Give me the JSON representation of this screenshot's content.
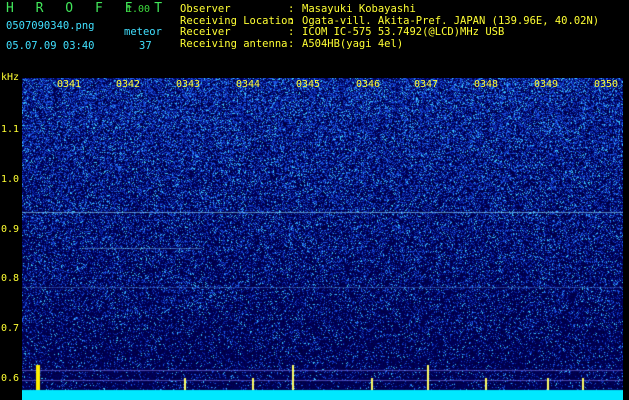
{
  "header": {
    "app_name": "H R O F F T",
    "version": "1.00",
    "file_name": "0507090340.png",
    "meteor_label": "meteor",
    "date_time": "05.07.09 03:40",
    "meteor_count": "37"
  },
  "metadata": [
    {
      "key": "Observer",
      "value": "Masayuki Kobayashi"
    },
    {
      "key": "Receiving Location",
      "value": "Ogata-vill. Akita-Pref. JAPAN (139.96E, 40.02N)"
    },
    {
      "key": "Receiver",
      "value": "ICOM IC-575 53.7492(@LCD)MHz USB"
    },
    {
      "key": "Receiving antenna",
      "value": "A504HB(yagi 4el)"
    }
  ],
  "spectrogram": {
    "y_unit": "kHz",
    "y_ticks": [
      "1.1",
      "1.0",
      "0.9",
      "0.8",
      "0.7",
      "0.6"
    ],
    "x_ticks": [
      "0341",
      "0342",
      "0343",
      "0344",
      "0345",
      "0346",
      "0347",
      "0348",
      "0349",
      "0350"
    ]
  },
  "colors": {
    "background": "#000000",
    "label": "#ffff33",
    "title": "#3ddc3d",
    "noise_floor": "#00ffff"
  }
}
